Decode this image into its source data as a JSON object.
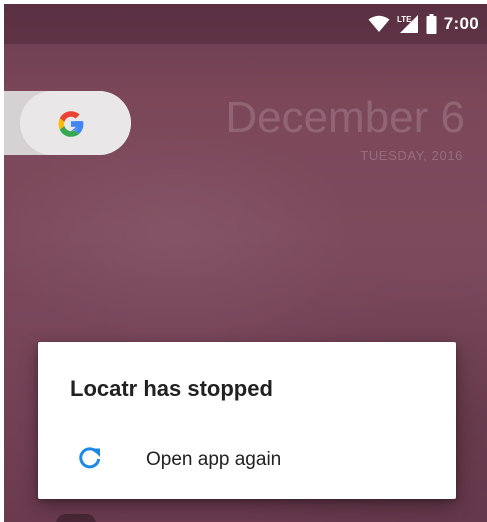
{
  "status_bar": {
    "time": "7:00",
    "icons": [
      "wifi-icon",
      "lte-icon",
      "battery-icon"
    ],
    "network_badge": "LTE"
  },
  "home": {
    "search_widget_icon": "google-g-icon",
    "date": "December 6",
    "day": "TUESDAY, 2016"
  },
  "dialog": {
    "title": "Locatr has stopped",
    "action_label": "Open app again",
    "action_icon": "reload-icon"
  },
  "colors": {
    "wallpaper": "#7b4759",
    "dialog_bg": "#ffffff",
    "accent": "#1e88e5",
    "text": "#212121"
  }
}
